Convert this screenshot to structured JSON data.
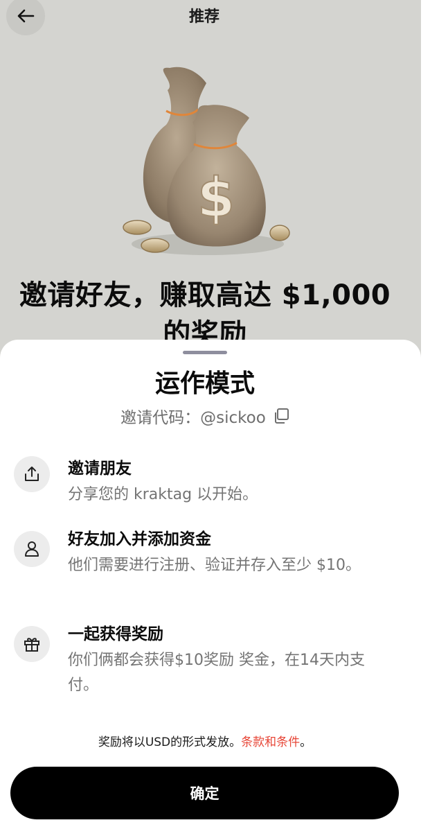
{
  "header": {
    "title": "推荐",
    "back_icon": "arrow-left-icon"
  },
  "hero": {
    "image": "money-bags-illustration",
    "headline_line1": "邀请好友，赚取高达 $1,000",
    "headline_line2": "的奖励"
  },
  "sheet": {
    "title": "运作模式",
    "code_label": "邀请代码：",
    "code_value": "@sickoo",
    "copy_icon": "copy-icon",
    "steps": [
      {
        "icon": "share-icon",
        "title": "邀请朋友",
        "desc": "分享您的 kraktag 以开始。"
      },
      {
        "icon": "person-icon",
        "title": "好友加入并添加资金",
        "desc": "他们需要进行注册、验证并存入至少 $10。"
      },
      {
        "icon": "gift-icon",
        "title": "一起获得奖励",
        "desc": "你们俩都会获得$10奖励 奖金，在14天内支付。"
      }
    ],
    "footnote_text": "奖励将以USD的形式发放。",
    "footnote_link": "条款和条件",
    "footnote_end": "。",
    "confirm_label": "确定"
  },
  "colors": {
    "backdrop": "#d4d4d0",
    "link": "#e74536",
    "button": "#000000"
  }
}
